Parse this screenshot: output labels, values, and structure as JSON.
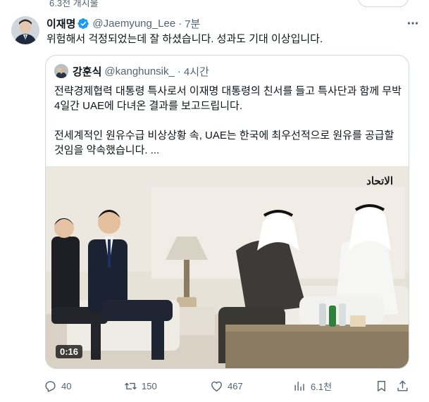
{
  "previous_tweet": {
    "partial_text": "6.3천 개시물"
  },
  "tweet": {
    "author": {
      "name": "이재명",
      "handle": "@Jaemyung_Lee",
      "verified": true
    },
    "time": "7분",
    "text": "위험해서 걱정되었는데 잘 하셨습니다. 성과도 기대 이상입니다.",
    "quote": {
      "author": {
        "name": "강훈식",
        "handle": "@kanghunsik_"
      },
      "time": "4시간",
      "paragraphs": [
        "전략경제협력 대통령 특사로서 이재명 대통령의 친서를 들고 특사단과 함께 무박 4일간 UAE에 다녀온 결과를 보고드립니다.",
        "전세계적인 원유수급 비상상황 속, UAE는 한국에 최우선적으로 원유를 공급할 것임을 약속했습니다. ..."
      ],
      "video": {
        "duration": "0:16",
        "watermark": "الاتحاد"
      }
    },
    "stats": {
      "replies": "40",
      "reposts": "150",
      "likes": "467",
      "views": "6.1천"
    }
  },
  "colors": {
    "text": "#0f1419",
    "secondary": "#536471",
    "border": "#cfd9de",
    "verified": "#1d9bf0"
  },
  "icons": [
    "more-icon",
    "verified-icon",
    "reply-icon",
    "repost-icon",
    "like-icon",
    "views-icon",
    "bookmark-icon",
    "share-icon"
  ]
}
